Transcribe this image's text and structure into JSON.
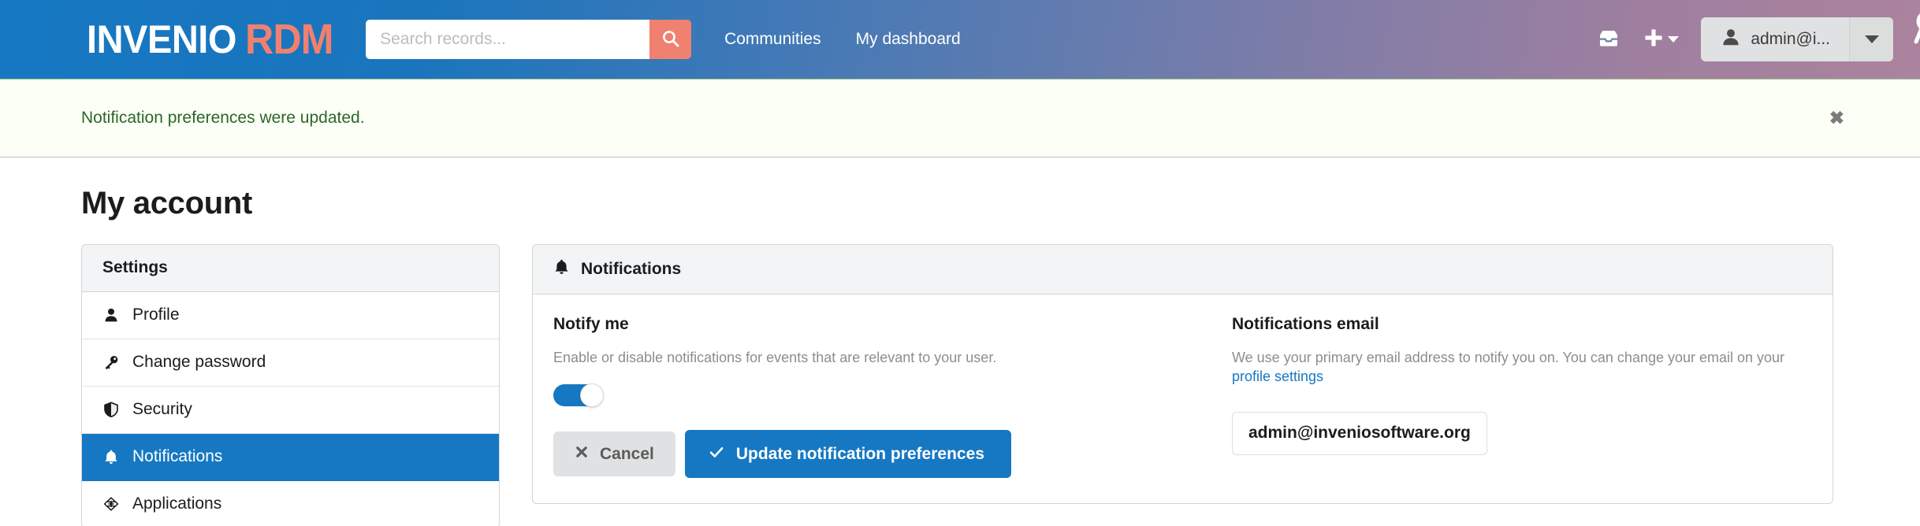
{
  "header": {
    "logo": {
      "primary": "INVENIO",
      "secondary": "RDM",
      "glass_icon": "magnifier-icon"
    },
    "search": {
      "placeholder": "Search records...",
      "value": "",
      "button_icon": "search-icon"
    },
    "nav": [
      {
        "label": "Communities",
        "name": "nav-communities"
      },
      {
        "label": "My dashboard",
        "name": "nav-my-dashboard"
      }
    ],
    "inbox_icon": "inbox-icon",
    "plus_icon": "plus-icon",
    "plus_caret_icon": "chevron-down-icon",
    "user": {
      "label": "admin@i...",
      "avatar_icon": "user-icon",
      "caret_icon": "chevron-down-icon"
    },
    "colors": {
      "gradient_start": "#1678c2",
      "gradient_end": "#ab839e",
      "accent": "#f0806f"
    }
  },
  "flash": {
    "message": "Notification preferences were updated.",
    "close_label": "✖",
    "text_color": "#2c662d",
    "background": "#fcfff5"
  },
  "page": {
    "title": "My account"
  },
  "sidebar": {
    "header": "Settings",
    "items": [
      {
        "label": "Profile",
        "icon": "user-icon",
        "active": false
      },
      {
        "label": "Change password",
        "icon": "key-icon",
        "active": false
      },
      {
        "label": "Security",
        "icon": "shield-icon",
        "active": false
      },
      {
        "label": "Notifications",
        "icon": "bell-icon",
        "active": true
      },
      {
        "label": "Applications",
        "icon": "cube-icon",
        "active": false
      }
    ],
    "active_color": "#1678c2"
  },
  "card": {
    "header": {
      "title": "Notifications",
      "icon": "bell-icon"
    },
    "notify_me": {
      "label": "Notify me",
      "help": "Enable or disable notifications for events that are relevant to your user.",
      "toggle_state": "on"
    },
    "notifications_email": {
      "label": "Notifications email",
      "help_prefix": "We use your primary email address to notify you on. You can change your email on your ",
      "help_link": "profile settings",
      "email": "admin@inveniosoftware.org"
    },
    "actions": {
      "cancel": {
        "label": "Cancel",
        "icon": "close-icon"
      },
      "submit": {
        "label": "Update notification preferences",
        "icon": "check-icon"
      }
    }
  }
}
